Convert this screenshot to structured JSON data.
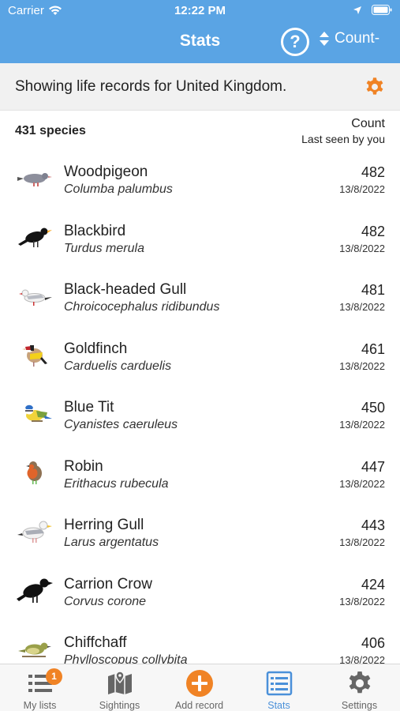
{
  "status_bar": {
    "carrier": "Carrier",
    "time": "12:22 PM"
  },
  "nav": {
    "title": "Stats",
    "help_label": "?",
    "sort_label": "Count-"
  },
  "region": {
    "text": "Showing life records for United Kingdom."
  },
  "list_header": {
    "species_count": "431 species",
    "count_label": "Count",
    "seen_label": "Last seen by you"
  },
  "birds": [
    {
      "common": "Woodpigeon",
      "scientific": "Columba palumbus",
      "count": "482",
      "date": "13/8/2022",
      "icon": "woodpigeon-icon"
    },
    {
      "common": "Blackbird",
      "scientific": "Turdus merula",
      "count": "482",
      "date": "13/8/2022",
      "icon": "blackbird-icon"
    },
    {
      "common": "Black-headed Gull",
      "scientific": "Chroicocephalus ridibundus",
      "count": "481",
      "date": "13/8/2022",
      "icon": "gull-icon"
    },
    {
      "common": "Goldfinch",
      "scientific": "Carduelis carduelis",
      "count": "461",
      "date": "13/8/2022",
      "icon": "goldfinch-icon"
    },
    {
      "common": "Blue Tit",
      "scientific": "Cyanistes caeruleus",
      "count": "450",
      "date": "13/8/2022",
      "icon": "blue-tit-icon"
    },
    {
      "common": "Robin",
      "scientific": "Erithacus rubecula",
      "count": "447",
      "date": "13/8/2022",
      "icon": "robin-icon"
    },
    {
      "common": "Herring Gull",
      "scientific": "Larus argentatus",
      "count": "443",
      "date": "13/8/2022",
      "icon": "herring-gull-icon"
    },
    {
      "common": "Carrion Crow",
      "scientific": "Corvus corone",
      "count": "424",
      "date": "13/8/2022",
      "icon": "crow-icon"
    },
    {
      "common": "Chiffchaff",
      "scientific": "Phylloscopus collybita",
      "count": "406",
      "date": "13/8/2022",
      "icon": "chiffchaff-icon"
    }
  ],
  "tabs": [
    {
      "label": "My lists",
      "icon": "list-icon",
      "badge": "1"
    },
    {
      "label": "Sightings",
      "icon": "map-icon"
    },
    {
      "label": "Add record",
      "icon": "add-icon"
    },
    {
      "label": "Stats",
      "icon": "stats-icon"
    },
    {
      "label": "Settings",
      "icon": "gear-icon"
    }
  ],
  "colors": {
    "nav_blue": "#5aa4e4",
    "accent_orange": "#f08325",
    "active_tab": "#4a90d9"
  }
}
